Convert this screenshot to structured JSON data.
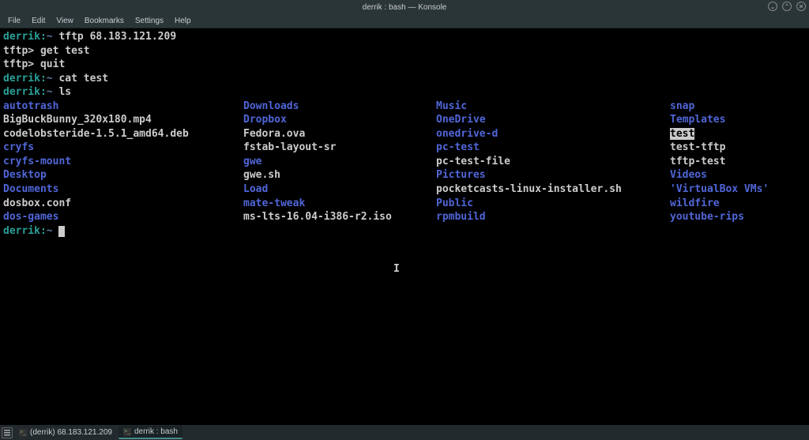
{
  "window": {
    "title": "derrik : bash — Konsole"
  },
  "menubar": [
    "File",
    "Edit",
    "View",
    "Bookmarks",
    "Settings",
    "Help"
  ],
  "win_controls": {
    "min": "⌄",
    "max": "⌃",
    "close": "✕"
  },
  "prompts": {
    "user": "derrik",
    "host_sep": ":",
    "path": "~",
    "tftp": "tftp>"
  },
  "commands": {
    "c1": "tftp 68.183.121.209",
    "c2": "get test",
    "c3": "quit",
    "c4": "cat test",
    "c5": "ls"
  },
  "ls": {
    "cols": [
      [
        {
          "n": "autotrash",
          "t": "dir"
        },
        {
          "n": "BigBuckBunny_320x180.mp4",
          "t": "file"
        },
        {
          "n": "codelobsteride-1.5.1_amd64.deb",
          "t": "file"
        },
        {
          "n": "cryfs",
          "t": "dir"
        },
        {
          "n": "cryfs-mount",
          "t": "dir"
        },
        {
          "n": "Desktop",
          "t": "dir"
        },
        {
          "n": "Documents",
          "t": "dir"
        },
        {
          "n": "dosbox.conf",
          "t": "file"
        },
        {
          "n": "dos-games",
          "t": "dir"
        }
      ],
      [
        {
          "n": "Downloads",
          "t": "dir"
        },
        {
          "n": "Dropbox",
          "t": "dir"
        },
        {
          "n": "Fedora.ova",
          "t": "file"
        },
        {
          "n": "fstab-layout-sr",
          "t": "file"
        },
        {
          "n": "gwe",
          "t": "dir"
        },
        {
          "n": "gwe.sh",
          "t": "file"
        },
        {
          "n": "Load",
          "t": "dir"
        },
        {
          "n": "mate-tweak",
          "t": "dir"
        },
        {
          "n": "ms-lts-16.04-i386-r2.iso",
          "t": "file"
        }
      ],
      [
        {
          "n": "Music",
          "t": "dir"
        },
        {
          "n": "OneDrive",
          "t": "dir"
        },
        {
          "n": "onedrive-d",
          "t": "dir"
        },
        {
          "n": "pc-test",
          "t": "dir"
        },
        {
          "n": "pc-test-file",
          "t": "file"
        },
        {
          "n": "Pictures",
          "t": "dir"
        },
        {
          "n": "pocketcasts-linux-installer.sh",
          "t": "file"
        },
        {
          "n": "Public",
          "t": "dir"
        },
        {
          "n": "rpmbuild",
          "t": "dir"
        }
      ],
      [
        {
          "n": "snap",
          "t": "dir"
        },
        {
          "n": "Templates",
          "t": "dir"
        },
        {
          "n": "test",
          "t": "hl"
        },
        {
          "n": "test-tftp",
          "t": "file"
        },
        {
          "n": "tftp-test",
          "t": "file"
        },
        {
          "n": "Videos",
          "t": "dir"
        },
        {
          "n": "'VirtualBox VMs'",
          "t": "quote"
        },
        {
          "n": "wildfire",
          "t": "dir"
        },
        {
          "n": "youtube-rips",
          "t": "dir"
        }
      ]
    ]
  },
  "taskbar": {
    "item1": "(derrik) 68.183.121.209",
    "item2": "derrik : bash"
  }
}
